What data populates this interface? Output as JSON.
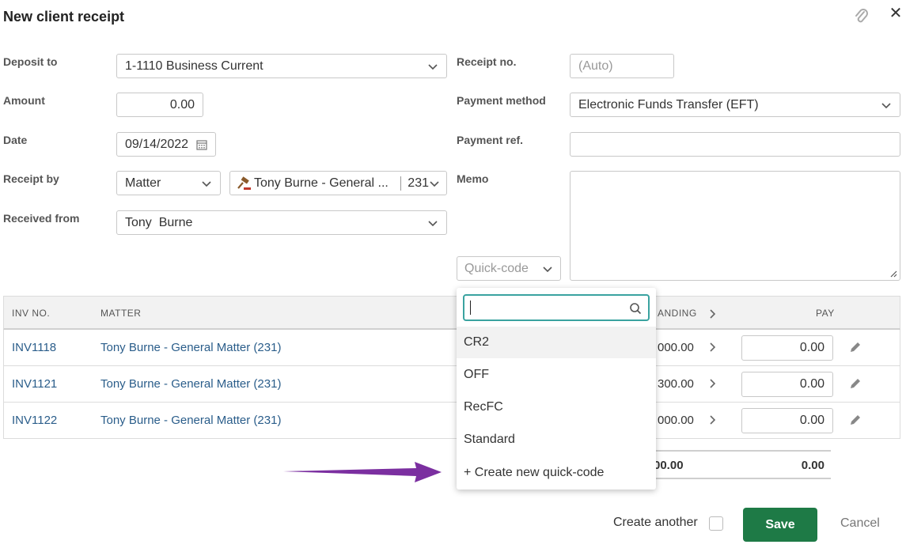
{
  "dialog": {
    "title": "New client receipt"
  },
  "form": {
    "deposit_to": {
      "label": "Deposit to",
      "value": "1-1110 Business Current"
    },
    "amount": {
      "label": "Amount",
      "value": "0.00"
    },
    "date": {
      "label": "Date",
      "value": "09/14/2022"
    },
    "receipt_by": {
      "label": "Receipt by",
      "type_value": "Matter",
      "matter_value": "Tony Burne - General ...",
      "matter_code": "231"
    },
    "received_from": {
      "label": "Received from",
      "value": "Tony  Burne"
    },
    "receipt_no": {
      "label": "Receipt no.",
      "placeholder": "(Auto)"
    },
    "payment_method": {
      "label": "Payment method",
      "value": "Electronic Funds Transfer (EFT)"
    },
    "payment_ref": {
      "label": "Payment ref.",
      "value": ""
    },
    "memo": {
      "label": "Memo",
      "value": ""
    },
    "quick_code": {
      "placeholder": "Quick-code"
    }
  },
  "table": {
    "columns": {
      "inv_no": "INV NO.",
      "matter": "MATTER",
      "outstanding": "ANDING",
      "pay": "PAY"
    },
    "rows": [
      {
        "inv_no": "INV1118",
        "matter": "Tony Burne - General Matter (231)",
        "outstanding": "000.00",
        "pay": "0.00"
      },
      {
        "inv_no": "INV1121",
        "matter": "Tony Burne - General Matter (231)",
        "outstanding": "300.00",
        "pay": "0.00"
      },
      {
        "inv_no": "INV1122",
        "matter": "Tony Burne - General Matter (231)",
        "outstanding": "000.00",
        "pay": "0.00"
      }
    ],
    "totals": {
      "outstanding": "00.00",
      "pay": "0.00"
    }
  },
  "quick_code_dropdown": {
    "search_value": "",
    "items": [
      "CR2",
      "OFF",
      "RecFC",
      "Standard"
    ],
    "create_label": "+ Create new quick-code"
  },
  "footer": {
    "create_another": "Create another",
    "save": "Save",
    "cancel": "Cancel"
  },
  "colors": {
    "primary": "#1e7a46",
    "link": "#2a5d8a",
    "focus": "#3aa3a0",
    "arrow": "#7b2fa0"
  },
  "icons": [
    "paperclip-icon",
    "close-icon",
    "chevron-down-icon",
    "calendar-icon",
    "gavel-icon",
    "search-icon",
    "chevron-right-icon",
    "pencil-icon",
    "resize-handle-icon"
  ]
}
